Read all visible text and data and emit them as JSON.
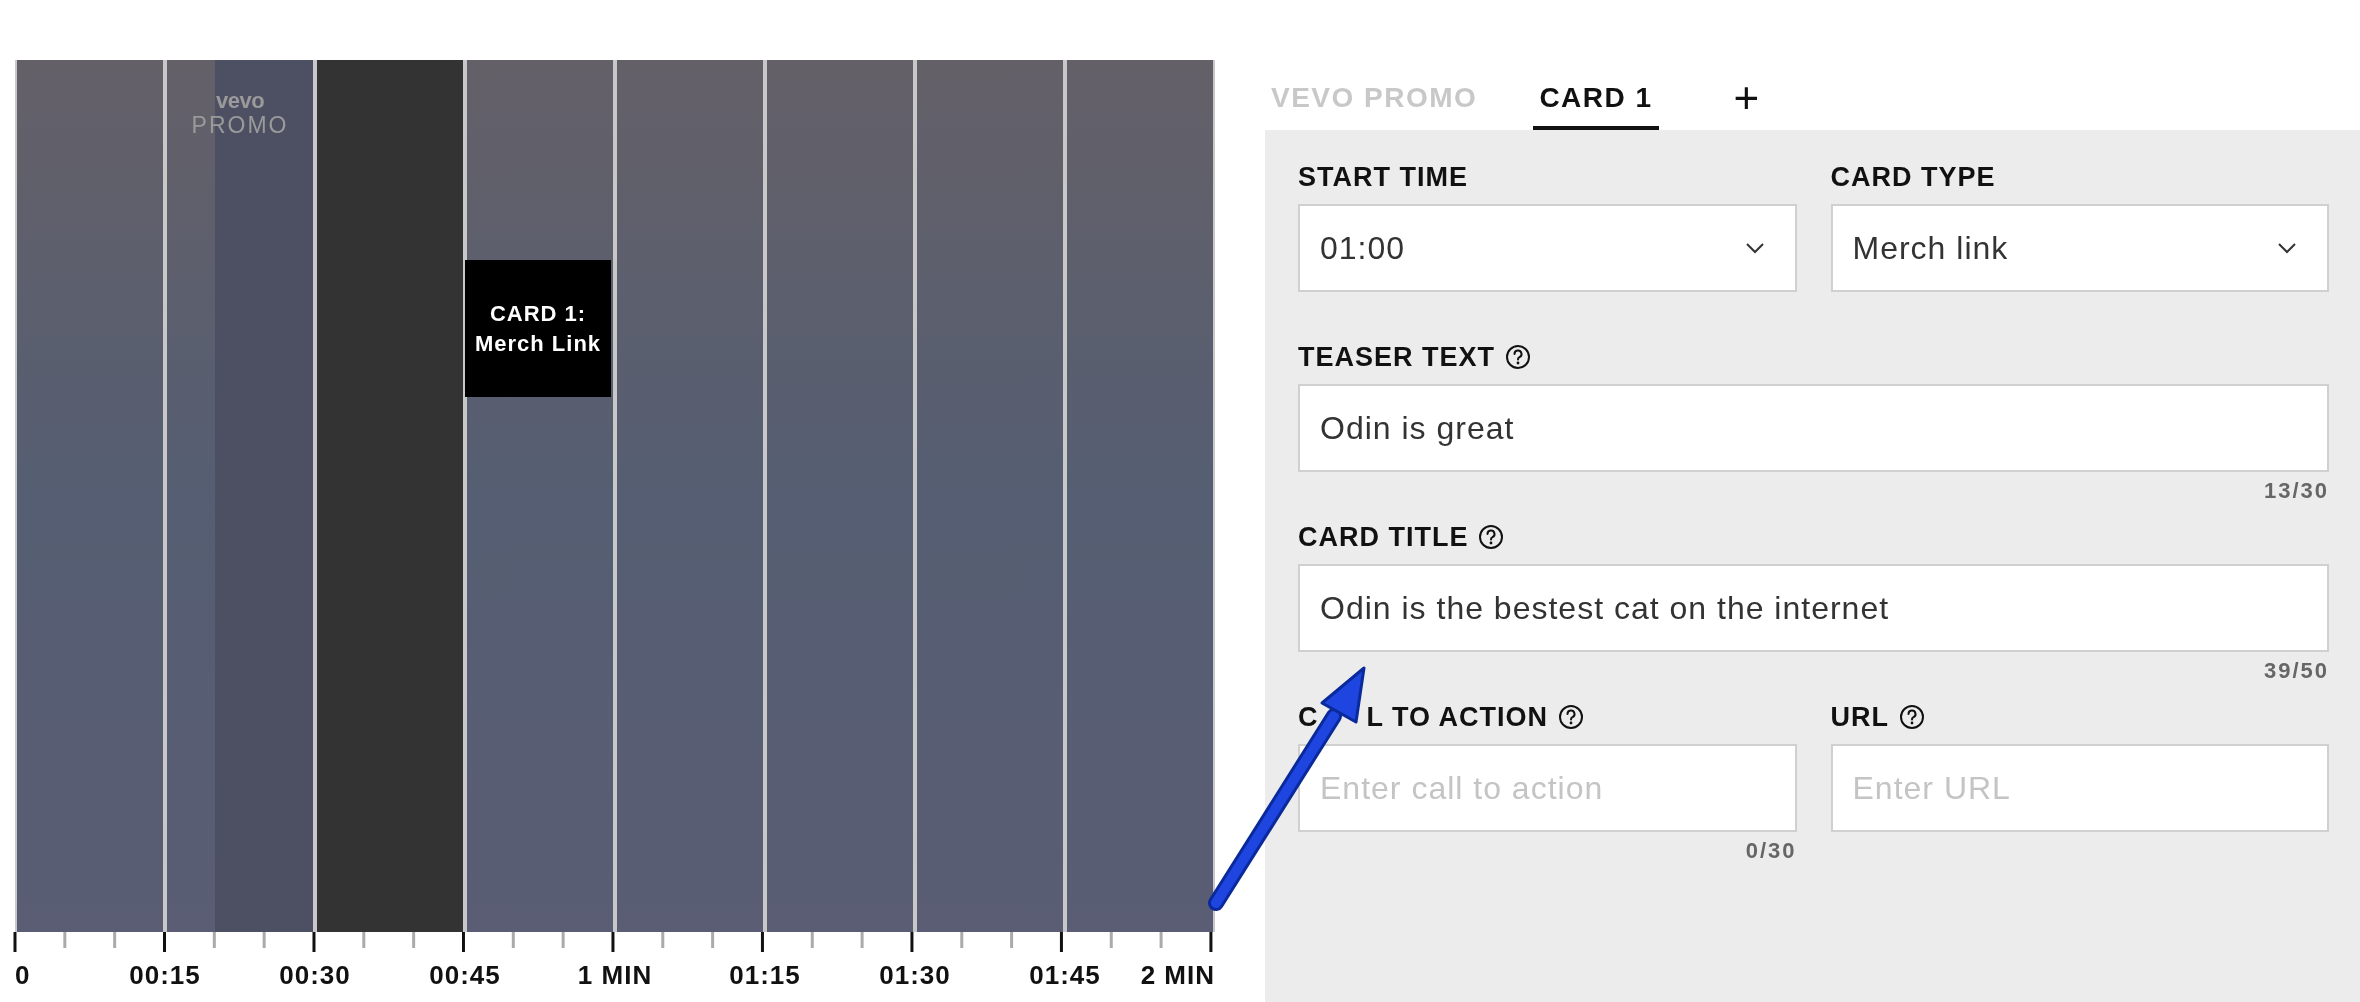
{
  "timeline": {
    "promo": {
      "logo": "vevo",
      "label": "PROMO"
    },
    "card": {
      "title": "CARD 1:",
      "subtitle": "Merch Link"
    },
    "ticks": [
      "0",
      "00:15",
      "00:30",
      "00:45",
      "1 MIN",
      "01:15",
      "01:30",
      "01:45",
      "2 MIN"
    ]
  },
  "tabs": [
    {
      "label": "VEVO PROMO",
      "selected": false
    },
    {
      "label": "CARD 1",
      "selected": true
    }
  ],
  "add_tab": "+",
  "form": {
    "rows": [
      [
        {
          "label": "START TIME",
          "kind": "select",
          "help": false,
          "value": "01:00"
        },
        {
          "label": "CARD TYPE",
          "kind": "select",
          "help": false,
          "value": "Merch link"
        }
      ],
      [
        {
          "label": "TEASER TEXT",
          "kind": "text",
          "help": true,
          "value": "Odin is great",
          "count": "13/30"
        }
      ],
      [
        {
          "label": "CARD TITLE",
          "kind": "text",
          "help": true,
          "value": "Odin is the bestest cat on the internet",
          "count": "39/50"
        }
      ],
      [
        {
          "label": "C",
          "label_after": "L TO ACTION",
          "kind": "text",
          "help": true,
          "placeholder": "Enter call to action",
          "count": "0/30"
        },
        {
          "label": "URL",
          "kind": "text",
          "help": true,
          "placeholder": "Enter URL"
        }
      ]
    ]
  }
}
